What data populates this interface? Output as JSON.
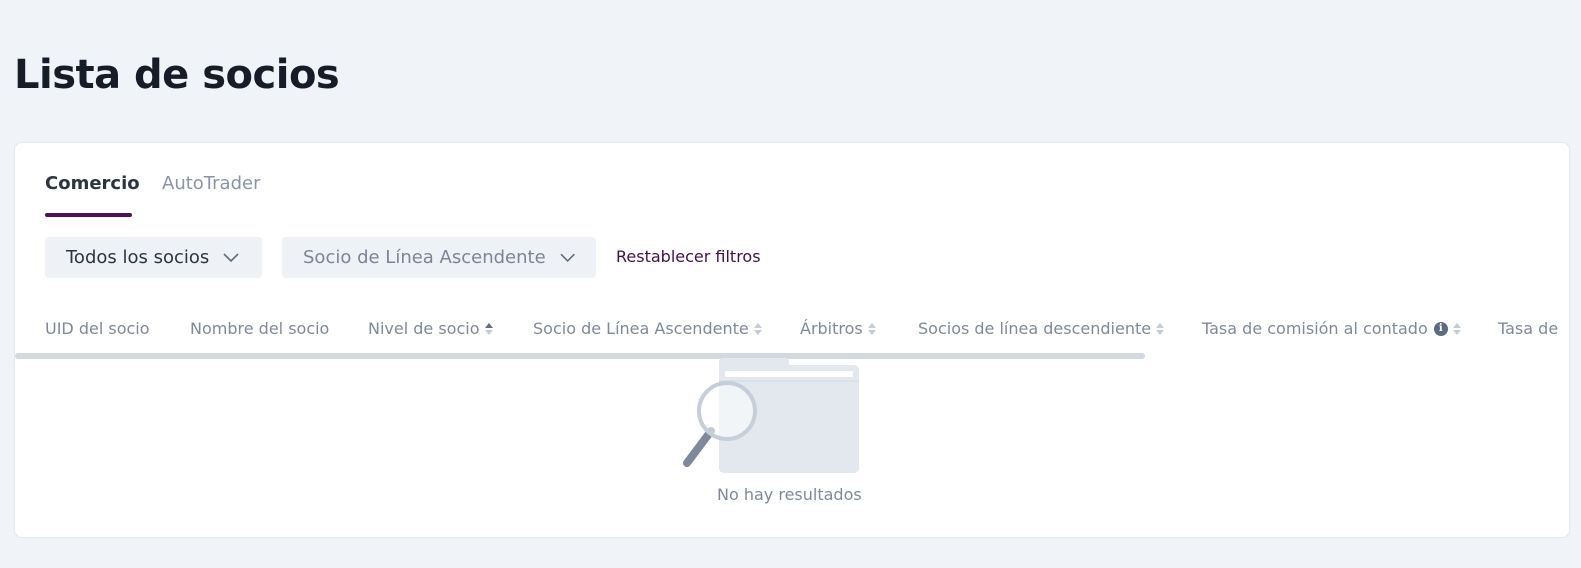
{
  "page": {
    "title": "Lista de socios"
  },
  "tabs": [
    {
      "label": "Comercio",
      "active": true
    },
    {
      "label": "AutoTrader",
      "active": false
    }
  ],
  "filters": {
    "partners_select": "Todos los socios",
    "upline_select": "Socio de Línea Ascendente",
    "reset_label": "Restablecer filtros"
  },
  "table": {
    "columns": [
      {
        "label": "UID del socio",
        "sortable": false
      },
      {
        "label": "Nombre del socio",
        "sortable": false
      },
      {
        "label": "Nivel de socio",
        "sortable": true,
        "sort": "asc"
      },
      {
        "label": "Socio de Línea Ascendente",
        "sortable": true
      },
      {
        "label": "Árbitros",
        "sortable": true
      },
      {
        "label": "Socios de línea descendiente",
        "sortable": true
      },
      {
        "label": "Tasa de comisión al contado",
        "sortable": true,
        "info": true
      },
      {
        "label": "Tasa de",
        "sortable": false
      }
    ],
    "empty_text": "No hay resultados"
  },
  "colors": {
    "accent": "#4e0f5b",
    "background": "#f0f3f7",
    "card": "#ffffff",
    "muted_text": "#7f899b"
  },
  "icons": {
    "filter_chevron": "chevron-down-icon",
    "info": "info-icon",
    "sort": "sort-icon",
    "empty": "empty-folder-search-icon"
  }
}
